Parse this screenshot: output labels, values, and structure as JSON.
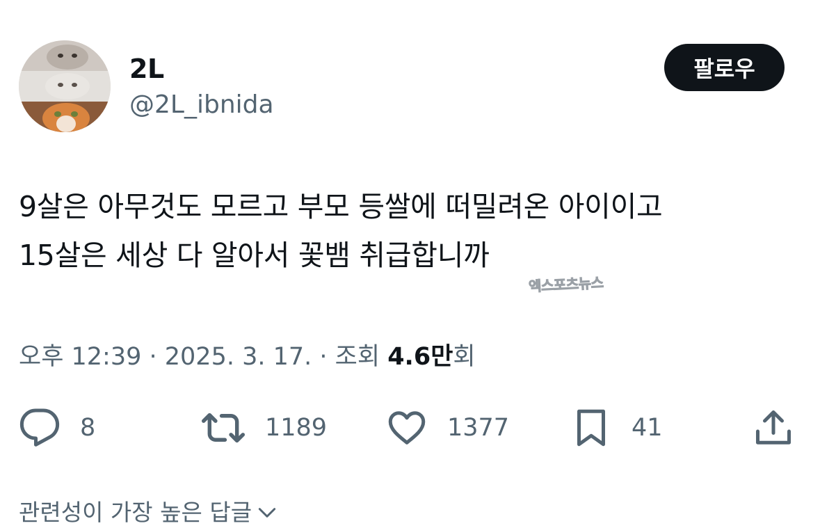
{
  "author": {
    "display_name": "2L",
    "handle": "@2L_ibnida",
    "avatar_icon": "cat-photo-avatar"
  },
  "follow_button": {
    "label": "팔로우"
  },
  "tweet": {
    "lines": [
      "9살은 아무것도 모르고 부모 등쌀에 떠밀려온 아이이고",
      "15살은 세상 다 알아서 꽃뱀 취급합니까"
    ],
    "watermark": "엑스포츠뉴스"
  },
  "meta": {
    "time_date": "오후 12:39 · 2025. 3. 17. · 조회 ",
    "views_count": "4.6만",
    "views_suffix": "회"
  },
  "actions": {
    "reply": {
      "icon": "reply-icon",
      "count": "8"
    },
    "retweet": {
      "icon": "retweet-icon",
      "count": "1189"
    },
    "like": {
      "icon": "like-icon",
      "count": "1377"
    },
    "bookmark": {
      "icon": "bookmark-icon",
      "count": "41"
    },
    "share": {
      "icon": "share-icon"
    }
  },
  "replies": {
    "sort_label": "관련성이 가장 높은 답글"
  },
  "colors": {
    "text_primary": "#0f1419",
    "text_secondary": "#536471",
    "button_bg": "#0f1419",
    "background": "#ffffff"
  }
}
